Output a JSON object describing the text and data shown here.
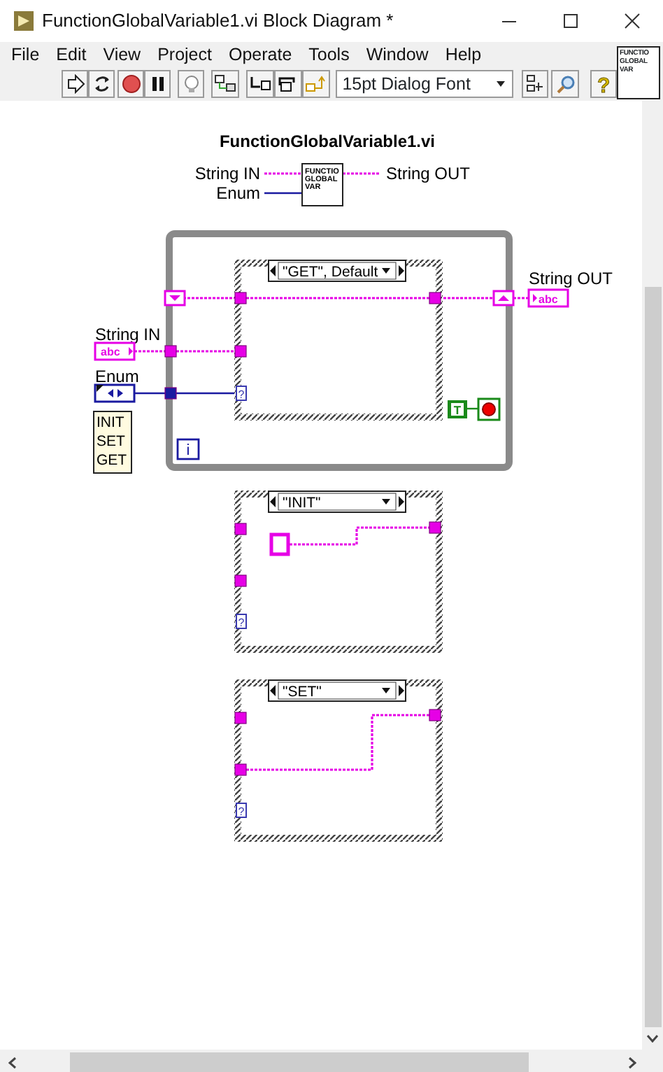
{
  "window": {
    "title": "FunctionGlobalVariable1.vi Block Diagram *"
  },
  "menu": [
    "File",
    "Edit",
    "View",
    "Project",
    "Operate",
    "Tools",
    "Window",
    "Help"
  ],
  "toolbar": {
    "font": "15pt Dialog Font",
    "help_glyph": "?"
  },
  "vi_icon": {
    "lines": [
      "FUNCTIO",
      "GLOBAL",
      "VAR"
    ]
  },
  "diagram": {
    "title": "FunctionGlobalVariable1.vi",
    "connector_pane": {
      "inputs": [
        "String IN",
        "Enum"
      ],
      "outputs": [
        "String OUT"
      ],
      "icon_lines": [
        "FUNCTIO",
        "GLOBAL",
        "VAR"
      ]
    },
    "controls": [
      {
        "kind": "string",
        "label": "String IN",
        "glyph": "abc"
      },
      {
        "kind": "enum",
        "label": "Enum",
        "items": [
          "INIT",
          "SET",
          "GET"
        ]
      }
    ],
    "indicators": [
      {
        "kind": "string",
        "label": "String OUT",
        "glyph": "abc"
      }
    ],
    "loop": {
      "iteration": "i",
      "stop_constant": "T"
    },
    "cases": [
      {
        "kind": "get",
        "selector": "\"GET\", Default",
        "selector_terminal": "?"
      },
      {
        "kind": "init",
        "selector": "\"INIT\"",
        "selector_terminal": "?"
      },
      {
        "kind": "set",
        "selector": "\"SET\"",
        "selector_terminal": "?"
      }
    ]
  }
}
